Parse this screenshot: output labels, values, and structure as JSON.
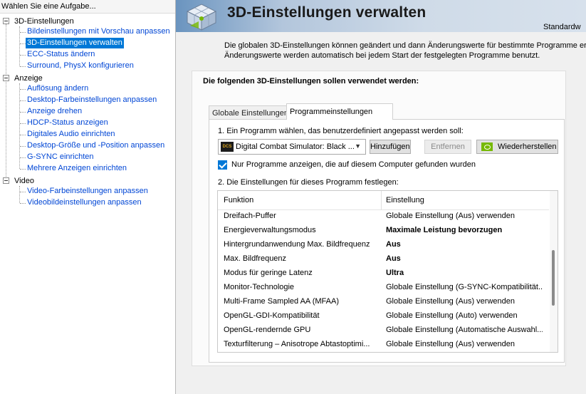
{
  "sidebar": {
    "header": "Wählen Sie eine Aufgabe...",
    "categories": [
      {
        "label": "3D-Einstellungen",
        "items": [
          "Bildeinstellungen mit Vorschau anpassen",
          "3D-Einstellungen verwalten",
          "ECC-Status ändern",
          "Surround, PhysX konfigurieren"
        ]
      },
      {
        "label": "Anzeige",
        "items": [
          "Auflösung ändern",
          "Desktop-Farbeinstellungen anpassen",
          "Anzeige drehen",
          "HDCP-Status anzeigen",
          "Digitales Audio einrichten",
          "Desktop-Größe und -Position anpassen",
          "G-SYNC einrichten",
          "Mehrere Anzeigen einrichten"
        ]
      },
      {
        "label": "Video",
        "items": [
          "Video-Farbeinstellungen anpassen",
          "Videobildeinstellungen anpassen"
        ]
      }
    ],
    "selected": "3D-Einstellungen verwalten"
  },
  "banner": {
    "title": "3D-Einstellungen verwalten",
    "right_text": "Standardw"
  },
  "description": {
    "line1": "Die globalen 3D-Einstellungen können geändert und dann Änderungswerte für bestimmte Programme erstellt",
    "line2": "Änderungswerte werden automatisch bei jedem Start der festgelegten Programme benutzt."
  },
  "card": {
    "title": "Die folgenden 3D-Einstellungen sollen verwendet werden:",
    "tabs": [
      "Globale Einstellungen",
      "Programmeinstellungen"
    ],
    "active_tab": "Programmeinstellungen",
    "step1_label": "1. Ein Programm wählen, das benutzerdefiniert angepasst werden soll:",
    "program": {
      "selected": "Digital Combat Simulator: Black ...",
      "icon_text": "DCS"
    },
    "buttons": {
      "add": "Hinzufügen",
      "remove": "Entfernen",
      "restore": "Wiederherstellen"
    },
    "checkbox_label": "Nur Programme anzeigen, die auf diesem Computer gefunden wurden",
    "step2_label": "2. Die Einstellungen für dieses Programm festlegen:",
    "table": {
      "columns": [
        "Funktion",
        "Einstellung"
      ],
      "rows": [
        {
          "function": "Dreifach-Puffer",
          "setting": "Globale Einstellung (Aus) verwenden",
          "bold": false
        },
        {
          "function": "Energieverwaltungsmodus",
          "setting": "Maximale Leistung bevorzugen",
          "bold": true
        },
        {
          "function": "Hintergrundanwendung Max. Bildfrequenz",
          "setting": "Aus",
          "bold": true
        },
        {
          "function": "Max. Bildfrequenz",
          "setting": "Aus",
          "bold": true
        },
        {
          "function": "Modus für geringe Latenz",
          "setting": "Ultra",
          "bold": true
        },
        {
          "function": "Monitor-Technologie",
          "setting": "Globale Einstellung (G-SYNC-Kompatibilität...",
          "bold": false
        },
        {
          "function": "Multi-Frame Sampled AA (MFAA)",
          "setting": "Globale Einstellung (Aus) verwenden",
          "bold": false
        },
        {
          "function": "OpenGL-GDI-Kompatibilität",
          "setting": "Globale Einstellung (Auto) verwenden",
          "bold": false
        },
        {
          "function": "OpenGL-rendernde GPU",
          "setting": "Globale Einstellung (Automatische Auswahl...",
          "bold": false
        },
        {
          "function": "Texturfilterung – Anisotrope Abtastoptimi...",
          "setting": "Globale Einstellung (Aus) verwenden",
          "bold": false
        }
      ]
    }
  }
}
